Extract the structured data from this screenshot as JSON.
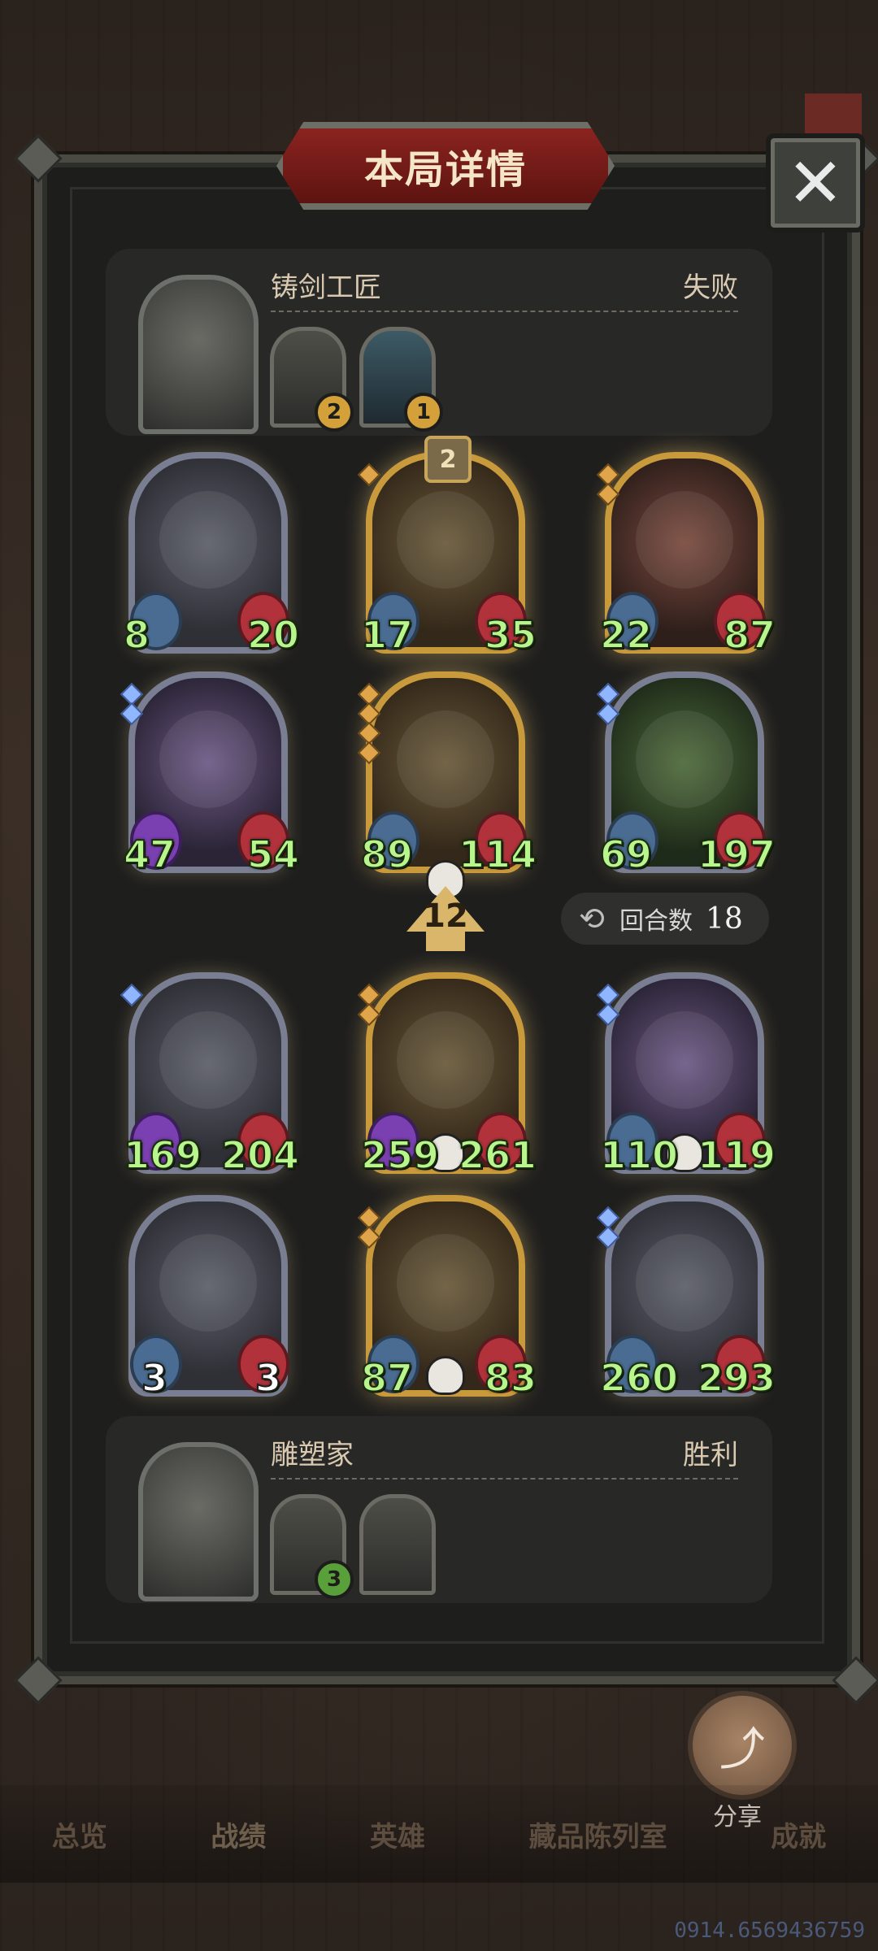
{
  "title": "本局详情",
  "close_icon": "close-icon",
  "top_player": {
    "name": "铸剑工匠",
    "result": "失败",
    "items": [
      {
        "count": "2"
      },
      {
        "count": "1"
      }
    ]
  },
  "bottom_player": {
    "name": "雕塑家",
    "result": "胜利",
    "items": [
      {
        "count": "3"
      },
      {
        "count": ""
      }
    ]
  },
  "top_board": [
    {
      "attack": "8",
      "health": "20"
    },
    {
      "attack": "17",
      "health": "35",
      "star": "2"
    },
    {
      "attack": "22",
      "health": "87"
    },
    {
      "attack": "47",
      "health": "54"
    },
    {
      "attack": "89",
      "health": "114"
    },
    {
      "attack": "69",
      "health": "197"
    }
  ],
  "bottom_board": [
    {
      "attack": "169",
      "health": "204"
    },
    {
      "attack": "259",
      "health": "261"
    },
    {
      "attack": "110",
      "health": "119"
    },
    {
      "attack": "3",
      "health": "3"
    },
    {
      "attack": "87",
      "health": "83"
    },
    {
      "attack": "260",
      "health": "293"
    }
  ],
  "level": "12",
  "rounds": {
    "label": "回合数",
    "value": "18"
  },
  "share": {
    "label": "分享"
  },
  "nav": [
    "总览",
    "战绩",
    "英雄",
    "藏品陈列室",
    "成就"
  ],
  "watermark": "0914.6569436759"
}
